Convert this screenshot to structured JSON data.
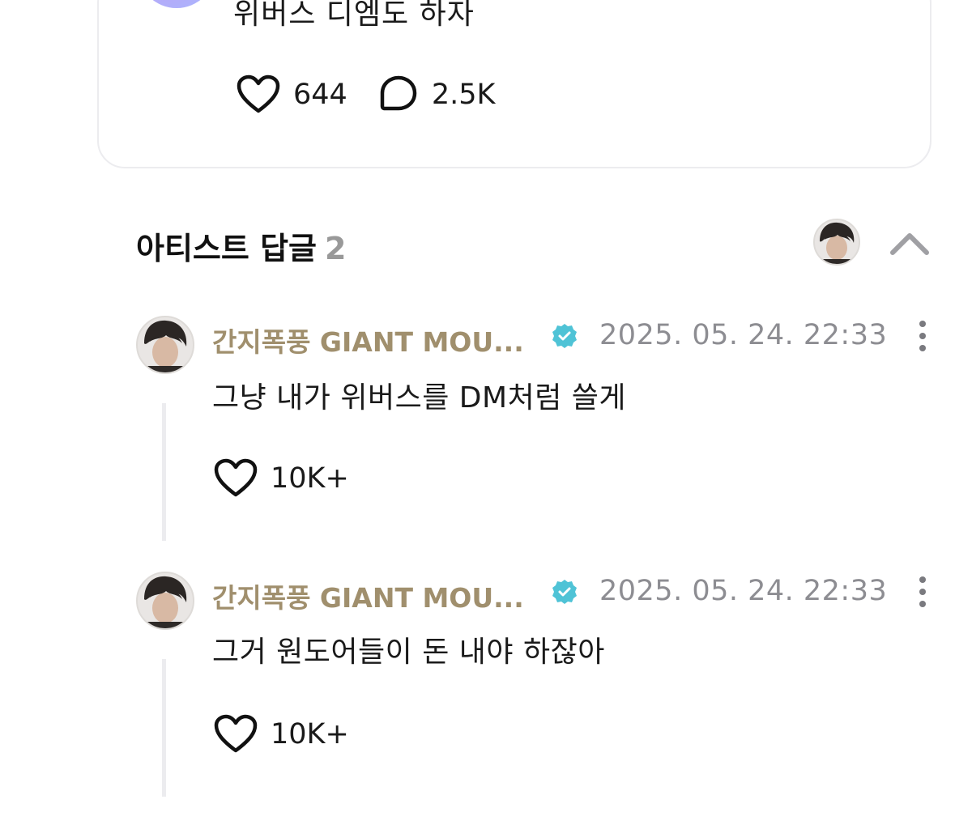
{
  "post": {
    "text": "위버스 디엠도 하자",
    "likes": "644",
    "comments": "2.5K"
  },
  "replies_section": {
    "title": "아티스트 답글",
    "count": "2"
  },
  "replies": [
    {
      "author": "간지폭풍 GIANT MOU...",
      "timestamp": "2025. 05. 24. 22:33",
      "text": "그냥 내가 위버스를 DM처럼 쓸게",
      "likes": "10K+"
    },
    {
      "author": "간지폭풍 GIANT MOU...",
      "timestamp": "2025. 05. 24. 22:33",
      "text": "그거 원도어들이 돈 내야 하잖아",
      "likes": "10K+"
    }
  ],
  "colors": {
    "artist_name": "#a08f6d",
    "verified_badge": "#4fc3d6",
    "muted_text": "#8d8d92",
    "card_border": "#ececef"
  },
  "icons": {
    "like": "heart-icon",
    "comment": "comment-bubble-icon",
    "verified": "verified-badge-icon",
    "more": "more-vertical-icon",
    "collapse": "chevron-up-icon"
  }
}
